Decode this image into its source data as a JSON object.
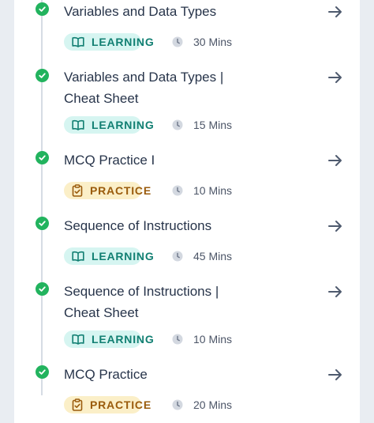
{
  "items": [
    {
      "title_lines": [
        "Variables and Data Types"
      ],
      "type_label": "LEARNING",
      "duration": "30 Mins"
    },
    {
      "title_lines": [
        "Variables and Data Types |",
        "Cheat Sheet"
      ],
      "type_label": "LEARNING",
      "duration": "15 Mins"
    },
    {
      "title_lines": [
        "MCQ Practice I"
      ],
      "type_label": "PRACTICE",
      "duration": "10 Mins"
    },
    {
      "title_lines": [
        "Sequence of Instructions"
      ],
      "type_label": "LEARNING",
      "duration": "45 Mins"
    },
    {
      "title_lines": [
        "Sequence of Instructions |",
        "Cheat Sheet"
      ],
      "type_label": "LEARNING",
      "duration": "10 Mins"
    },
    {
      "title_lines": [
        "MCQ Practice"
      ],
      "type_label": "PRACTICE",
      "duration": "20 Mins"
    }
  ],
  "colors": {
    "check": "#22b35e",
    "learning_bg": "#d6f5f1",
    "learning_fg": "#117f72",
    "practice_bg": "#fbefc8",
    "practice_fg": "#9a5b0c",
    "title": "#27344a"
  },
  "icons": {
    "status": "check-circle-icon",
    "learning": "book-open-icon",
    "practice": "clipboard-check-icon",
    "duration": "clock-icon",
    "open": "arrow-right-icon"
  }
}
